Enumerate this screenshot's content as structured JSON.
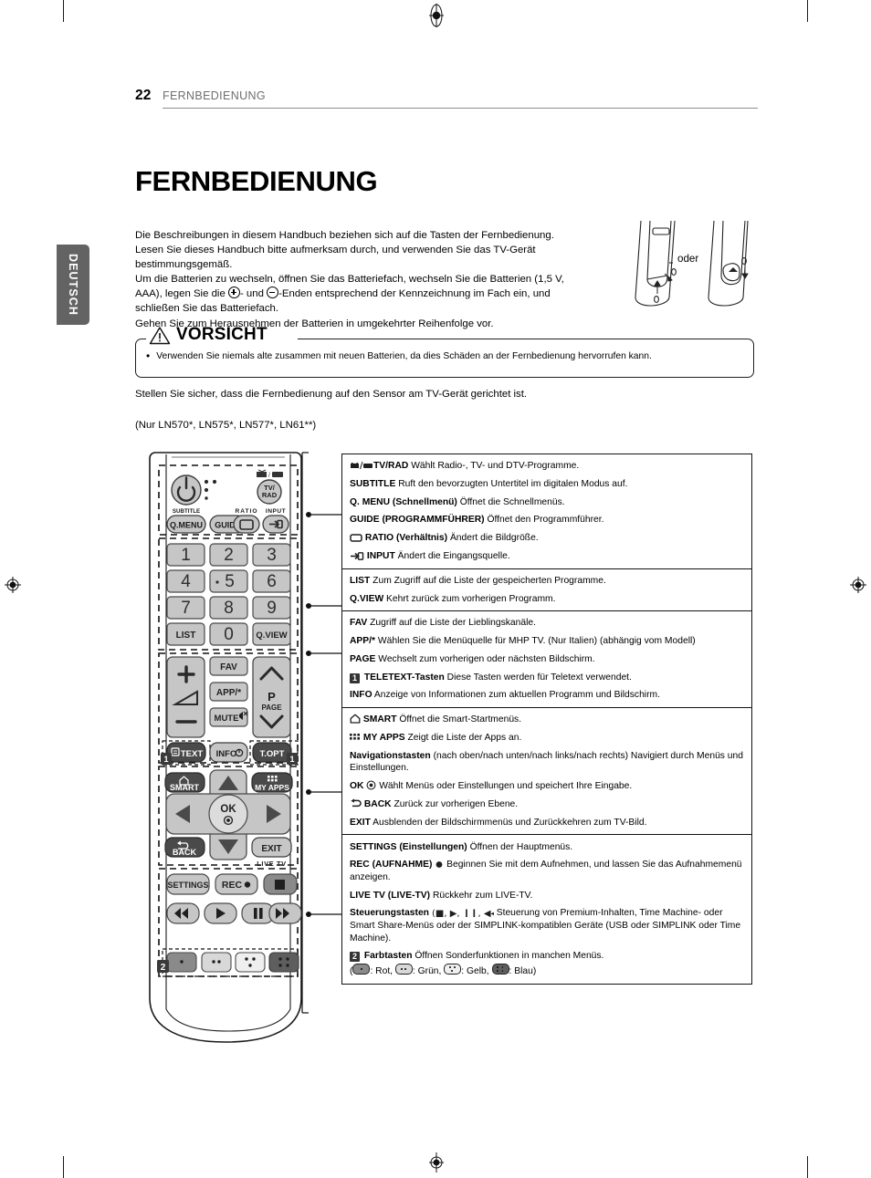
{
  "header": {
    "page_number": "22",
    "chapter": "FERNBEDIENUNG"
  },
  "main_title": "FERNBEDIENUNG",
  "language_tab": "DEUTSCH",
  "intro": {
    "line1": "Die Beschreibungen in diesem Handbuch beziehen sich auf die Tasten der Fernbedienung.",
    "line2": "Lesen Sie dieses Handbuch bitte aufmerksam durch, und verwenden Sie das TV-Gerät",
    "line3": "bestimmungsgemäß.",
    "line4a": "Um die Batterien zu wechseln, öffnen Sie das Batteriefach, wechseln Sie die Batterien (1,5 V,",
    "line5a": "AAA), legen Sie die ",
    "line5b": "- und ",
    "line5c": "-Enden entsprechend der Kennzeichnung im Fach ein, und",
    "line6": "schließen Sie das Batteriefach.",
    "line7": "Gehen Sie zum Herausnehmen der Batterien in umgekehrter Reihenfolge vor."
  },
  "battery_figure": {
    "or_label": "oder"
  },
  "caution": {
    "title": "VORSICHT",
    "bullet": "•",
    "text": "Verwenden Sie niemals alte zusammen mit neuen Batterien, da dies Schäden an der Fernbedienung hervorrufen kann."
  },
  "notes": {
    "sensor_note": "Stellen Sie sicher, dass die Fernbedienung auf den Sensor am TV-Gerät gerichtet ist.",
    "model_note": "(Nur  LN570*, LN575*, LN577*, LN61**)"
  },
  "remote": {
    "buttons": {
      "power": "power-icon",
      "tv_rad": "TV/\nRAD",
      "subtitle": "SUBTITLE",
      "q_menu": "Q.MENU",
      "guide": "GUIDE",
      "ratio": "RATIO",
      "input": "INPUT",
      "num1": "1",
      "num2": "2",
      "num3": "3",
      "num4": "4",
      "num5": "5",
      "num6": "6",
      "num7": "7",
      "num8": "8",
      "num9": "9",
      "list": "LIST",
      "num0": "0",
      "qview": "Q.VIEW",
      "fav": "FAV",
      "app": "APP/*",
      "mute": "MUTE",
      "p_page": "P",
      "page": "PAGE",
      "text": "TEXT",
      "info": "INFO",
      "topt": "T.OPT",
      "smart": "SMART",
      "my_apps": "MY APPS",
      "ok": "OK",
      "back": "BACK",
      "exit": "EXIT",
      "live_tv": "LIVE TV",
      "settings": "SETTINGS",
      "rec": "REC",
      "badge1": "1",
      "badge2": "2"
    }
  },
  "description_table": {
    "sections": [
      {
        "rows": [
          {
            "icon": "tv-rad-icon",
            "bold": "TV/RAD",
            "text": " Wählt Radio-, TV- und DTV-Programme."
          },
          {
            "icon": "",
            "bold": "SUBTITLE",
            "text": " Ruft den bevorzugten Untertitel im digitalen Modus auf."
          },
          {
            "icon": "",
            "bold": "Q. MENU (Schnellmenü)",
            "text": " Öffnet die Schnellmenüs."
          },
          {
            "icon": "",
            "bold": "GUIDE (PROGRAMMFÜHRER)",
            "text": " Öffnet den Programmführer."
          },
          {
            "icon": "ratio-icon",
            "bold": "RATIO (Verhältnis)",
            "text": " Ändert die Bildgröße."
          },
          {
            "icon": "input-icon",
            "bold": "INPUT",
            "text": " Ändert die Eingangsquelle."
          }
        ]
      },
      {
        "rows": [
          {
            "icon": "",
            "bold": "LIST",
            "text": " Zum Zugriff auf die Liste der gespeicherten Programme."
          },
          {
            "icon": "",
            "bold": "Q.VIEW",
            "text": " Kehrt zurück zum vorherigen Programm."
          }
        ]
      },
      {
        "rows": [
          {
            "icon": "",
            "bold": "FAV",
            "text": " Zugriff auf die Liste der Lieblingskanäle."
          },
          {
            "icon": "",
            "bold": "APP/*",
            "text": " Wählen Sie die Menüquelle für MHP TV. (Nur Italien) (abhängig vom Modell)"
          },
          {
            "icon": "",
            "bold": "PAGE",
            "text": " Wechselt zum vorherigen oder nächsten Bildschirm."
          },
          {
            "icon": "badge-1",
            "bold": "TELETEXT-Tasten",
            "text": " Diese Tasten werden für Teletext verwendet."
          },
          {
            "icon": "",
            "bold": "INFO",
            "text": " Anzeige von Informationen zum aktuellen Programm und Bildschirm."
          }
        ]
      },
      {
        "rows": [
          {
            "icon": "home-icon",
            "bold": "SMART",
            "text": " Öffnet die Smart-Startmenüs."
          },
          {
            "icon": "grid-icon",
            "bold": "MY APPS",
            "text": " Zeigt die Liste der Apps an."
          },
          {
            "icon": "",
            "bold": "Navigationstasten",
            "text": " (nach oben/nach unten/nach links/nach rechts) Navigiert durch Menüs und Einstellungen."
          },
          {
            "icon": "ok-dot-icon",
            "bold": "OK",
            "text": " Wählt Menüs oder Einstellungen und speichert Ihre Eingabe."
          },
          {
            "icon": "back-arrow-icon",
            "bold": "BACK",
            "text": " Zurück zur vorherigen Ebene."
          },
          {
            "icon": "",
            "bold": "EXIT",
            "text": " Ausblenden der Bildschirmmenüs und Zurückkehren zum TV-Bild."
          }
        ]
      },
      {
        "rows": [
          {
            "icon": "",
            "bold": "SETTINGS (Einstellungen)",
            "text": " Öffnen der Hauptmenüs."
          },
          {
            "icon": "rec-dot-icon",
            "bold": "REC (AUFNAHME)",
            "text": " Beginnen Sie mit dem Aufnehmen, und lassen Sie das Aufnahmemenü anzeigen."
          },
          {
            "icon": "",
            "bold": "LIVE TV (LIVE-TV)",
            "text": " Rückkehr zum LIVE-TV."
          },
          {
            "icon": "transport-icons",
            "bold": "Steuerungstasten",
            "text": " Steuerung von Premium-Inhalten, Time Machine- oder Smart Share-Menüs oder der SIMPLINK-kompatiblen Geräte (USB oder SIMPLINK oder Time Machine)."
          },
          {
            "icon": "badge-2",
            "bold": "Farbtasten",
            "text": " Öffnen Sonderfunktionen in manchen Menüs."
          }
        ],
        "color_legend": {
          "red": ": Rot,",
          "green": ": Grün,",
          "yellow": ": Gelb,",
          "blue": ": Blau)"
        }
      }
    ]
  },
  "colors": {
    "tab_bg": "#636363",
    "rule": "#8c8c8c",
    "chapter_text": "#6f6f6f",
    "table_border": "#111111",
    "remote_body": "#ffffff",
    "button_gray": "#b9b9b9",
    "button_dark": "#4a4a4a"
  }
}
